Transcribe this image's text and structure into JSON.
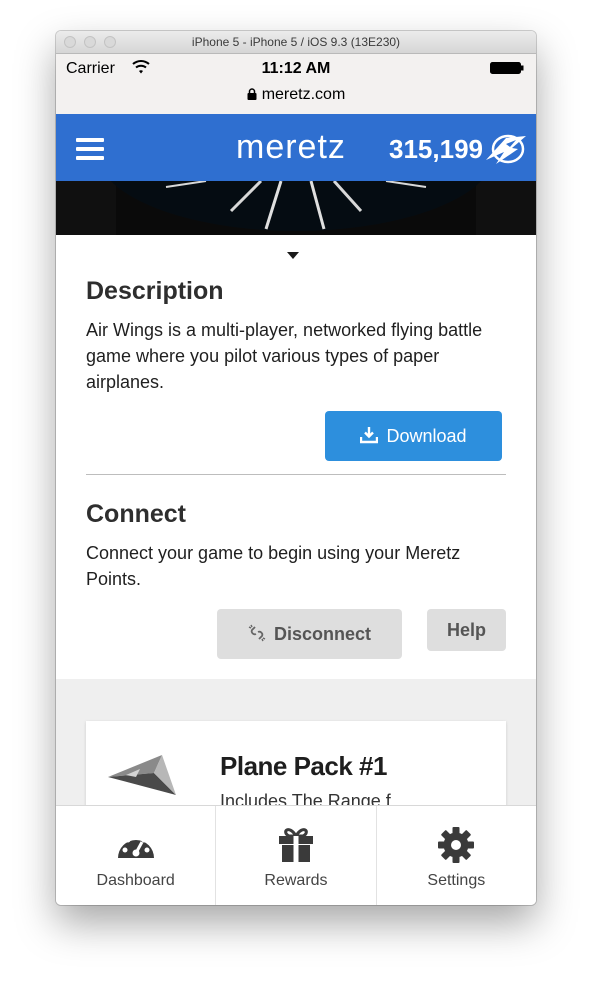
{
  "window": {
    "title": "iPhone 5 - iPhone 5 / iOS 9.3 (13E230)"
  },
  "status_bar": {
    "carrier": "Carrier",
    "time": "11:12 AM",
    "url": "meretz.com"
  },
  "app_bar": {
    "brand": "meretz",
    "points": "315,199",
    "icon": "meretz-bolt-icon"
  },
  "description": {
    "heading": "Description",
    "text": "Air Wings is a multi-player, networked flying battle game where you pilot various types of paper airplanes.",
    "download_label": "Download"
  },
  "connect": {
    "heading": "Connect",
    "text": "Connect your game to begin using your Meretz Points.",
    "disconnect_label": "Disconnect",
    "help_label": "Help"
  },
  "card": {
    "title": "Plane Pack #1",
    "subtitle": "Includes The Range f"
  },
  "tabs": [
    {
      "label": "Dashboard",
      "icon": "dashboard-icon"
    },
    {
      "label": "Rewards",
      "icon": "gift-icon"
    },
    {
      "label": "Settings",
      "icon": "gear-icon"
    }
  ],
  "colors": {
    "brand_blue": "#2f6fd0",
    "download_blue": "#2d8fdd",
    "button_grey": "#dedede"
  }
}
